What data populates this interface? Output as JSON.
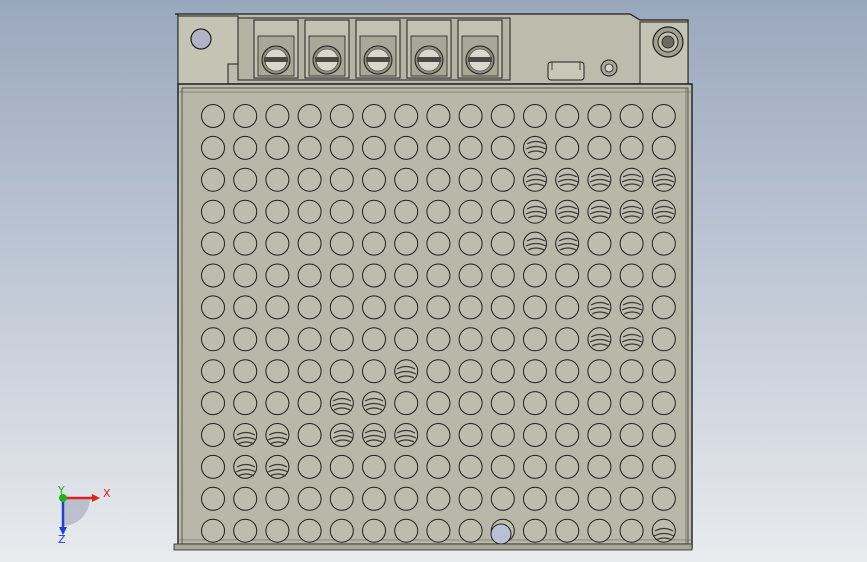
{
  "viewport": {
    "background_top": "#9aa8be",
    "background_bottom": "#e9ebee"
  },
  "model": {
    "body_color": "#b8b8a8",
    "body_light": "#c6c6b6",
    "edge_color": "#1e1e1e",
    "hole_dark": "#5a5a52",
    "terminal_count": 5
  },
  "triad": {
    "x_label": "X",
    "y_label": "Y",
    "z_label": "Z",
    "x_color": "#e02020",
    "y_color": "#20b020",
    "z_color": "#2040d0"
  }
}
